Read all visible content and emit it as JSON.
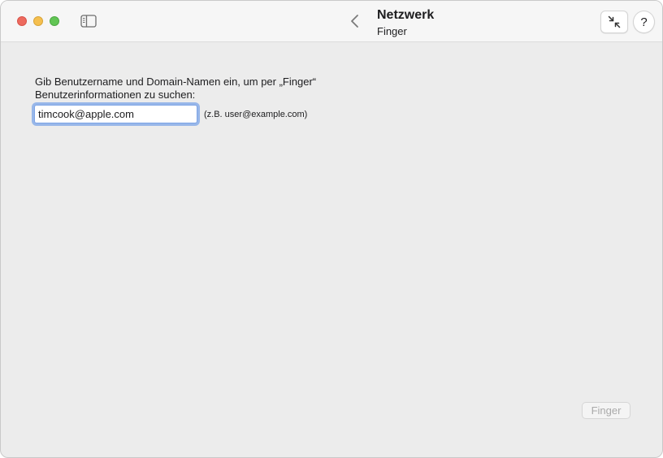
{
  "window": {
    "title": "Netzwerk",
    "subtitle": "Finger"
  },
  "toolbar": {
    "sidebar_icon": "sidebar-icon",
    "back_icon": "chevron-left-icon",
    "collapse_icon": "arrows-collapse-icon",
    "help_label": "?"
  },
  "form": {
    "prompt": "Gib Benutzername und Domain-Namen ein, um per „Finger“ Benutzerinformationen zu suchen:",
    "input_value": "timcook@apple.com",
    "hint": "(z.B. user@example.com)",
    "submit_label": "Finger",
    "submit_enabled": false
  },
  "colors": {
    "close": "#ed6a5e",
    "minimize": "#f5bf4f",
    "maximize": "#61c554",
    "focus_ring": "#548ce8"
  }
}
